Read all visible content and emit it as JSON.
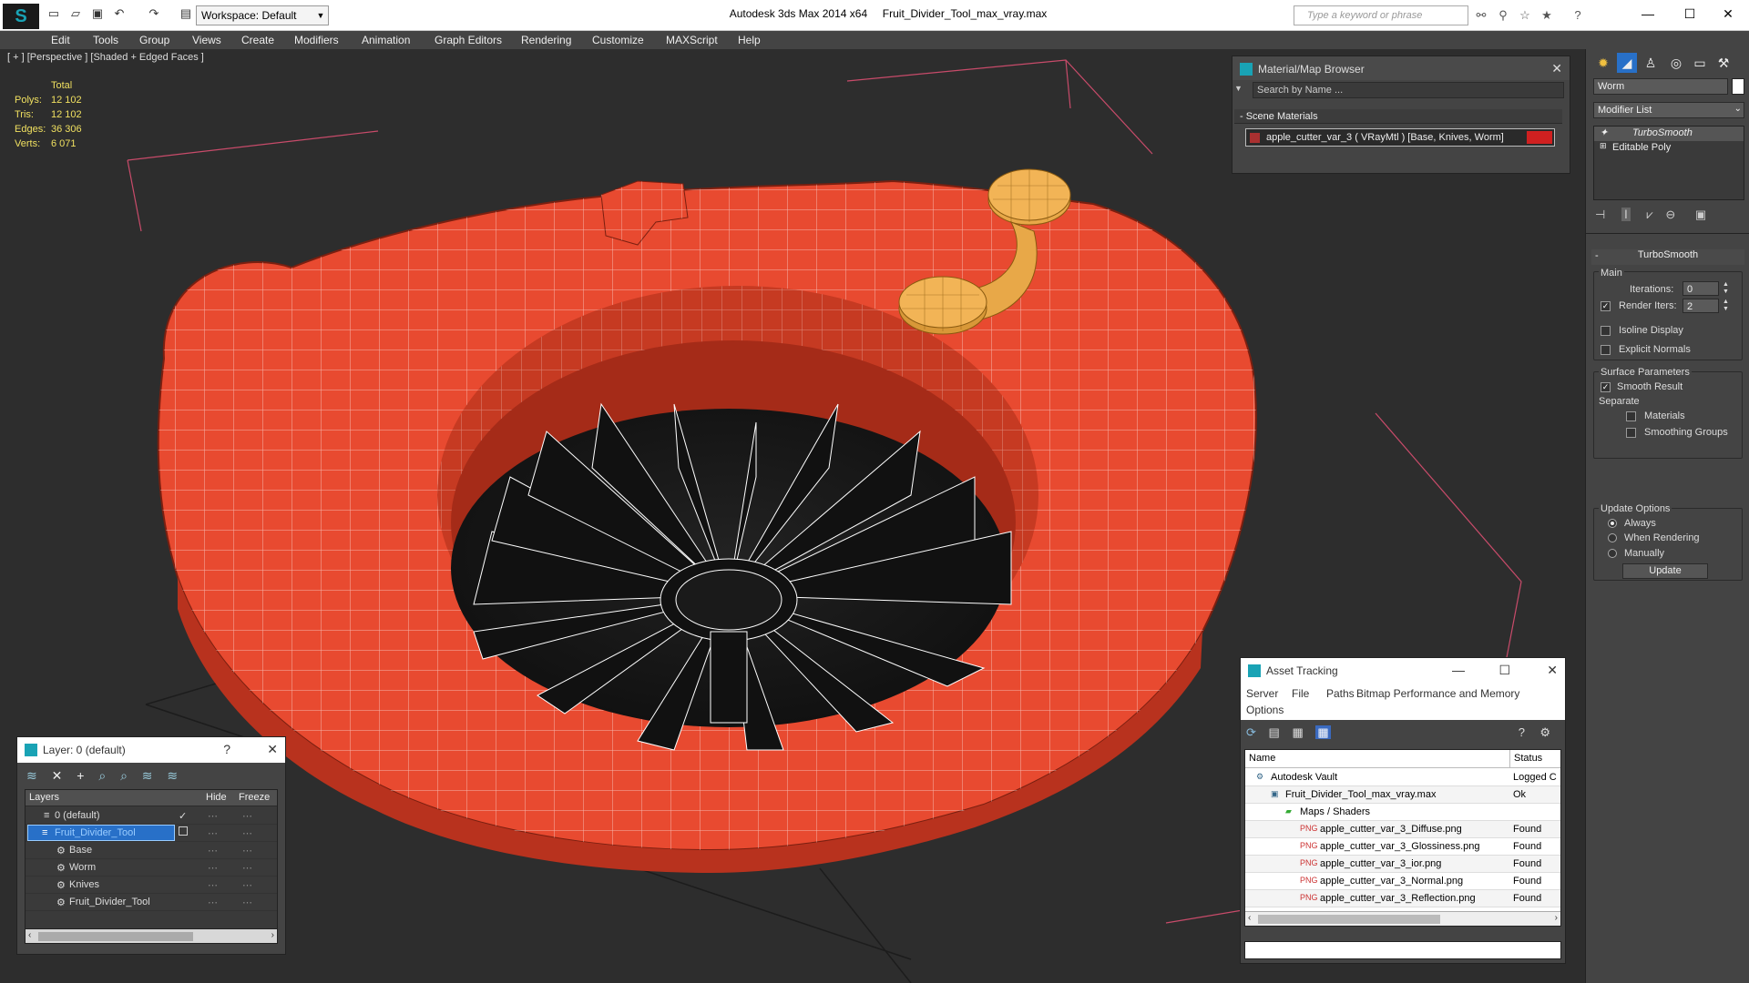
{
  "titlebar": {
    "app": "Autodesk 3ds Max  2014 x64",
    "file": "Fruit_Divider_Tool_max_vray.max",
    "workspace": "Workspace: Default",
    "search_placeholder": "Type a keyword or phrase"
  },
  "menu": [
    "Edit",
    "Tools",
    "Group",
    "Views",
    "Create",
    "Modifiers",
    "Animation",
    "Graph Editors",
    "Rendering",
    "Customize",
    "MAXScript",
    "Help"
  ],
  "viewport": {
    "label": "[ + ] [Perspective ] [Shaded + Edged Faces ]",
    "stats_header": "Total",
    "stats": [
      {
        "k": "Polys:",
        "v": "12 102"
      },
      {
        "k": "Tris:",
        "v": "12 102"
      },
      {
        "k": "Edges:",
        "v": "36 306"
      },
      {
        "k": "Verts:",
        "v": "6 071"
      }
    ]
  },
  "material_browser": {
    "title": "Material/Map Browser",
    "search": "Search by Name ...",
    "section": "- Scene Materials",
    "item": "apple_cutter_var_3  ( VRayMtl )  [Base, Knives, Worm]"
  },
  "layer_panel": {
    "title": "Layer: 0 (default)",
    "col_layers": "Layers",
    "col_hide": "Hide",
    "col_freeze": "Freeze",
    "rows": [
      {
        "name": "0 (default)"
      },
      {
        "name": "Fruit_Divider_Tool"
      },
      {
        "name": "Base"
      },
      {
        "name": "Worm"
      },
      {
        "name": "Knives"
      },
      {
        "name": "Fruit_Divider_Tool"
      }
    ]
  },
  "asset_tracking": {
    "title": "Asset Tracking",
    "menu": [
      "Server",
      "File",
      "Paths",
      "Bitmap Performance and Memory",
      "Options"
    ],
    "col_name": "Name",
    "col_status": "Status",
    "rows": [
      {
        "name": "Autodesk Vault",
        "status": "Logged C",
        "indent": 1
      },
      {
        "name": "Fruit_Divider_Tool_max_vray.max",
        "status": "Ok",
        "indent": 2
      },
      {
        "name": "Maps / Shaders",
        "status": "",
        "indent": 3
      },
      {
        "name": "apple_cutter_var_3_Diffuse.png",
        "status": "Found",
        "indent": 4
      },
      {
        "name": "apple_cutter_var_3_Glossiness.png",
        "status": "Found",
        "indent": 4
      },
      {
        "name": "apple_cutter_var_3_ior.png",
        "status": "Found",
        "indent": 4
      },
      {
        "name": "apple_cutter_var_3_Normal.png",
        "status": "Found",
        "indent": 4
      },
      {
        "name": "apple_cutter_var_3_Reflection.png",
        "status": "Found",
        "indent": 4
      }
    ]
  },
  "command_panel": {
    "object_name": "Worm",
    "modifier_list": "Modifier List",
    "stack": [
      "TurboSmooth",
      "Editable Poly"
    ],
    "rollout": "TurboSmooth",
    "main": "Main",
    "iterations_label": "Iterations:",
    "iterations": "0",
    "render_iters_label": "Render Iters:",
    "render_iters": "2",
    "isoline": "Isoline Display",
    "explicit": "Explicit Normals",
    "surface": "Surface Parameters",
    "smooth": "Smooth Result",
    "separate": "Separate",
    "materials": "Materials",
    "smoothing": "Smoothing Groups",
    "update_options": "Update Options",
    "always": "Always",
    "when_rendering": "When Rendering",
    "manually": "Manually",
    "update": "Update"
  }
}
